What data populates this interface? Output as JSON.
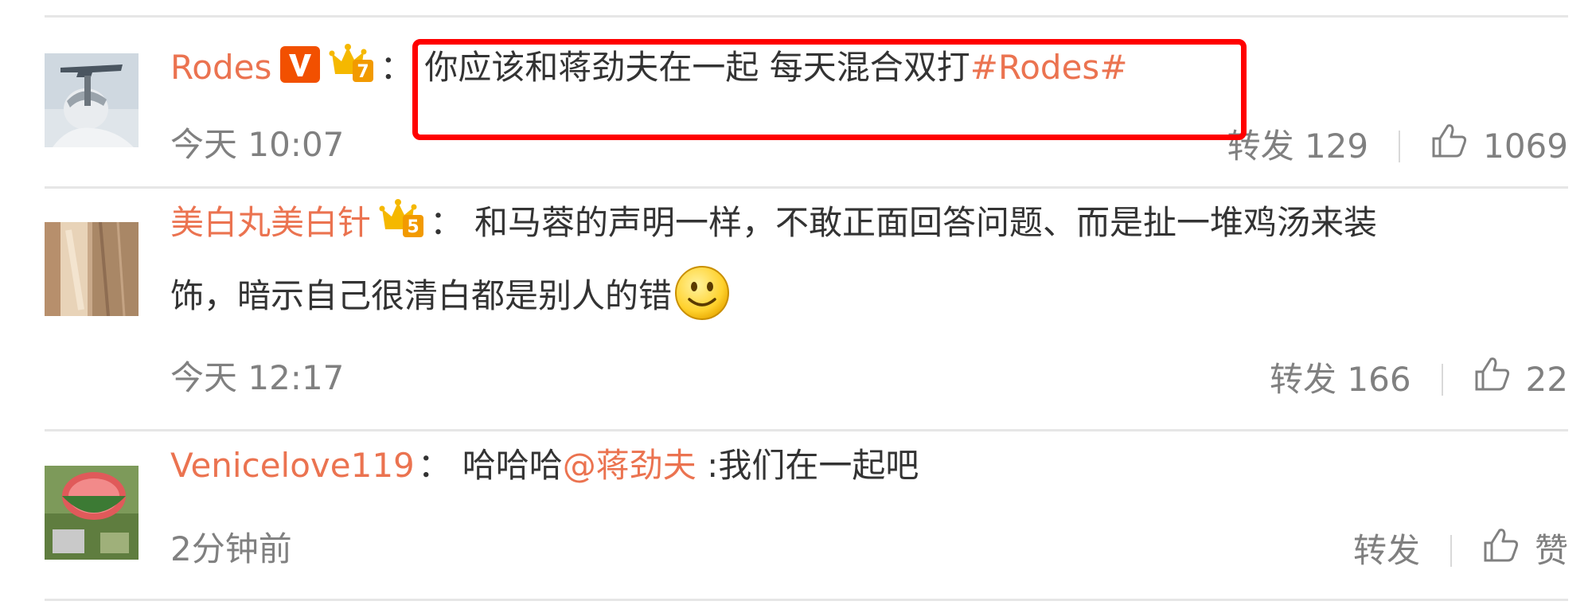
{
  "comments": [
    {
      "username": "Rodes",
      "colon": "：",
      "text": "你应该和蒋劲夫在一起 每天混合双打",
      "tag": "#Rodes#",
      "time": "今天 10:07",
      "repost_label": "转发",
      "repost_count": "129",
      "like_count": "1069",
      "verified": true,
      "vip_level": "7"
    },
    {
      "username": "美白丸美白针",
      "colon": "：",
      "text_line1": "和马蓉的声明一样，不敢正面回答问题、而是扯一堆鸡汤来装",
      "text_line2": "饰，暗示自己很清白都是别人的错",
      "emoji": "smiley-icon",
      "time": "今天 12:17",
      "repost_label": "转发",
      "repost_count": "166",
      "like_count": "22",
      "vip_level": "5"
    },
    {
      "username": "Venicelove119",
      "colon": "：",
      "text_before": "哈哈哈",
      "mention": "@蒋劲夫",
      "text_after": " :我们在一起吧",
      "time": "2分钟前",
      "repost_label": "转发",
      "like_label": "赞"
    }
  ],
  "colors": {
    "username": "#eb7350",
    "text": "#333333",
    "meta": "#808080",
    "divider": "#e6e6e6",
    "highlight": "#ff0000",
    "vip": "#f5a623",
    "verified": "#f25000"
  }
}
